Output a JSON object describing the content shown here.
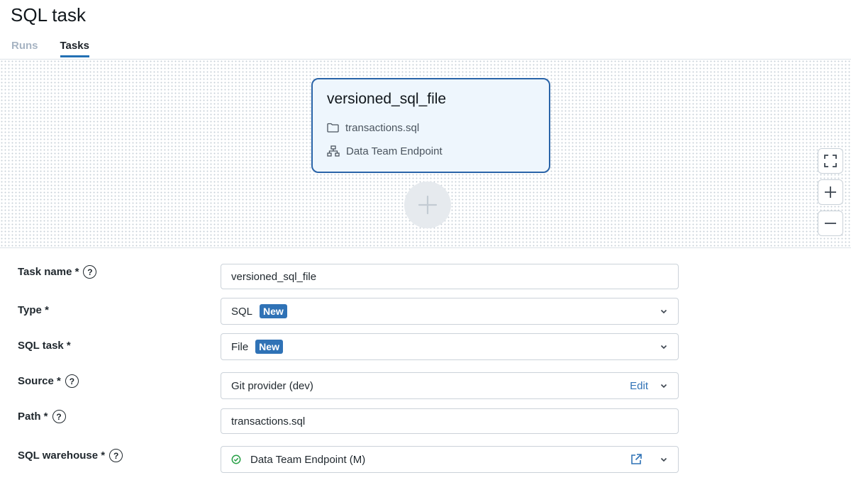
{
  "page": {
    "title": "SQL task"
  },
  "tabs": [
    {
      "label": "Runs",
      "active": false
    },
    {
      "label": "Tasks",
      "active": true
    }
  ],
  "canvas": {
    "node": {
      "title": "versioned_sql_file",
      "file": "transactions.sql",
      "file_icon": "folder-icon",
      "endpoint": "Data Team Endpoint",
      "endpoint_icon": "hierarchy-icon"
    },
    "add_icon": "plus-icon",
    "controls": [
      "fullscreen-icon",
      "zoom-in-icon",
      "zoom-out-icon"
    ]
  },
  "form": {
    "task_name": {
      "label": "Task name *",
      "value": "versioned_sql_file"
    },
    "type": {
      "label": "Type *",
      "value": "SQL",
      "badge": "New"
    },
    "sql_task": {
      "label": "SQL task *",
      "value": "File",
      "badge": "New"
    },
    "source": {
      "label": "Source *",
      "value": "Git provider (dev)",
      "action": "Edit"
    },
    "path": {
      "label": "Path *",
      "value": "transactions.sql"
    },
    "sql_warehouse": {
      "label": "SQL warehouse *",
      "value": "Data Team Endpoint (M)",
      "status_color": "#27a046"
    }
  },
  "colors": {
    "accent": "#2f72b6",
    "node_border": "#2a64a8",
    "node_bg": "#eef6fd"
  }
}
